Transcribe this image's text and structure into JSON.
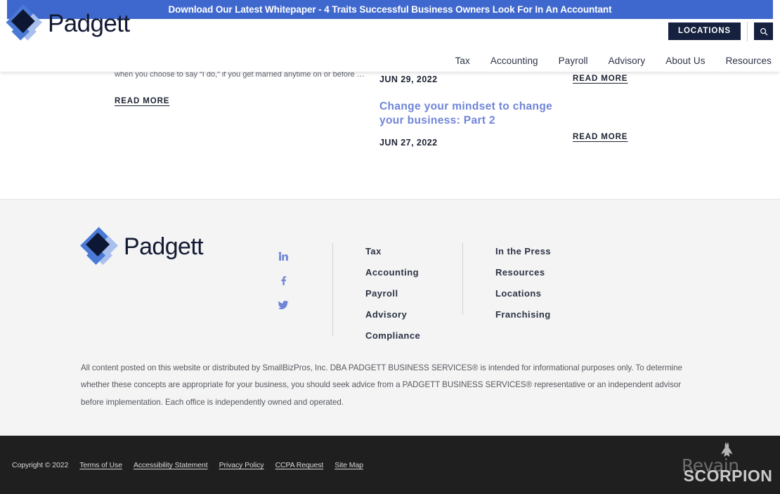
{
  "promo_banner": {
    "text": "Download Our Latest Whitepaper - 4 Traits Successful Business Owners Look For In An Accountant",
    "background_color": "#3f68ce",
    "text_color": "#ffffff"
  },
  "header": {
    "brand_name": "Padgett",
    "logo_icon": "padgett-diamond-logo",
    "locations_button": "LOCATIONS",
    "search_icon": "search-icon",
    "nav_items": [
      {
        "label": "Tax"
      },
      {
        "label": "Accounting"
      },
      {
        "label": "Payroll"
      },
      {
        "label": "Advisory"
      },
      {
        "label": "About Us"
      },
      {
        "label": "Resources"
      }
    ],
    "button_color": "#16213f"
  },
  "blog": {
    "read_more_label": "READ MORE",
    "posts": [
      {
        "excerpt": "when you choose to say “I do,” if you get married anytime on or before …",
        "title": "",
        "date": "JUN 29, 2022",
        "read_more": "READ MORE"
      },
      {
        "excerpt": "",
        "title": "Change your mindset to change your business: Part 2",
        "date": "JUN 27, 2022",
        "read_more": "READ MORE"
      }
    ],
    "title_color": "#6f84d8"
  },
  "footer": {
    "brand_name": "Padgett",
    "logo_icon": "padgett-diamond-logo",
    "social": [
      {
        "name": "linkedin-icon",
        "label": "LinkedIn"
      },
      {
        "name": "facebook-icon",
        "label": "Facebook"
      },
      {
        "name": "twitter-icon",
        "label": "Twitter"
      }
    ],
    "nav_column_1": [
      {
        "label": "Tax"
      },
      {
        "label": "Accounting"
      },
      {
        "label": "Payroll"
      },
      {
        "label": "Advisory"
      },
      {
        "label": "Compliance"
      }
    ],
    "nav_column_2": [
      {
        "label": "In the Press"
      },
      {
        "label": "Resources"
      },
      {
        "label": "Locations"
      },
      {
        "label": "Franchising"
      }
    ],
    "disclaimer": "All content posted on this website or distributed by SmallBizPros, Inc. DBA PADGETT BUSINESS SERVICES® is intended for informational purposes only. To determine whether these concepts are appropriate for your business, you should seek advice from a PADGETT BUSINESS SERVICES® representative or an independent advisor before implementation. Each office is independently owned and operated.",
    "background_color": "#f4f4f4"
  },
  "bottom_bar": {
    "copyright": "Copyright © 2022",
    "links": [
      {
        "label": "Terms of Use"
      },
      {
        "label": "Accessibility Statement"
      },
      {
        "label": "Privacy Policy"
      },
      {
        "label": "CCPA Request"
      },
      {
        "label": "Site Map"
      }
    ],
    "agency_name": "SCORPION",
    "agency_icon": "scorpion-logo",
    "watermark_text": "Revain",
    "background_color": "#1f1f1f"
  }
}
